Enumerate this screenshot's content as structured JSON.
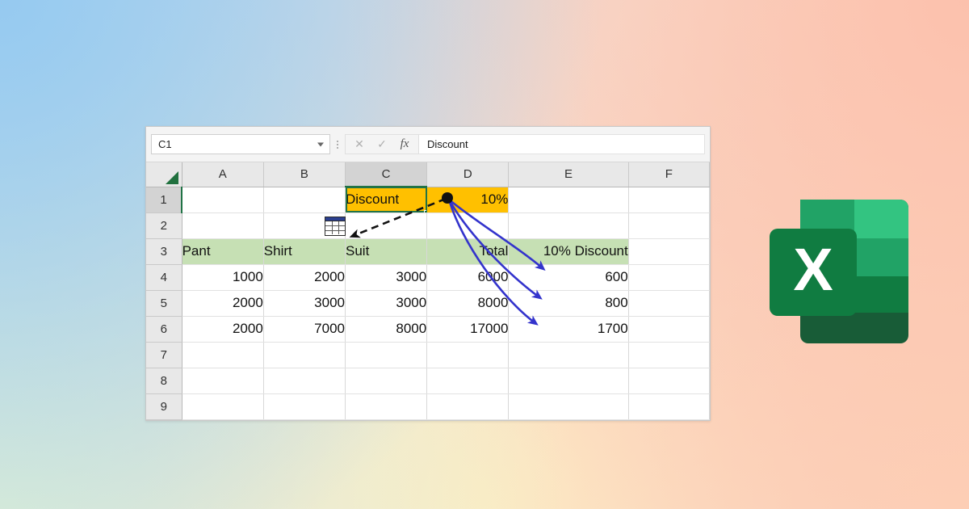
{
  "background": {
    "gradient_colors": [
      "#96CAF0",
      "#FCC1AD",
      "#DEEED6",
      "#FDD1B7",
      "#FDF3C6"
    ]
  },
  "excel": {
    "name_box": {
      "value": "C1",
      "placeholder": "Name Box"
    },
    "toolbar": {
      "cancel_label": "✕",
      "enter_label": "✓",
      "fx_label": "fx",
      "handle_dots": "⋮"
    },
    "formula_bar": {
      "value": "Discount",
      "placeholder": ""
    },
    "columns": [
      "A",
      "B",
      "C",
      "D",
      "E",
      "F"
    ],
    "selected_column": "C",
    "rows": [
      "1",
      "2",
      "3",
      "4",
      "5",
      "6",
      "7",
      "8",
      "9"
    ],
    "selected_row": "1",
    "selected_cell": "C1",
    "cells": {
      "row1": {
        "A": "",
        "B": "",
        "C": "Discount",
        "D": "10%",
        "E": "",
        "F": ""
      },
      "row2": {
        "A": "",
        "B": "",
        "C": "",
        "D": "",
        "E": "",
        "F": ""
      },
      "row3": {
        "A": "Pant",
        "B": "Shirt",
        "C": "Suit",
        "D": "Total",
        "E": "10% Discount",
        "F": ""
      },
      "row4": {
        "A": "1000",
        "B": "2000",
        "C": "3000",
        "D": "6000",
        "E": "600",
        "F": ""
      },
      "row5": {
        "A": "2000",
        "B": "3000",
        "C": "3000",
        "D": "8000",
        "E": "800",
        "F": ""
      },
      "row6": {
        "A": "2000",
        "B": "7000",
        "C": "8000",
        "D": "17000",
        "E": "1700",
        "F": ""
      },
      "row7": {
        "A": "",
        "B": "",
        "C": "",
        "D": "",
        "E": "",
        "F": ""
      },
      "row8": {
        "A": "",
        "B": "",
        "C": "",
        "D": "",
        "E": "",
        "F": ""
      },
      "row9": {
        "A": "",
        "B": "",
        "C": "",
        "D": "",
        "E": "",
        "F": ""
      }
    },
    "fill_colors": {
      "header_row_green": "#C6E0B4",
      "discount_orange": "#FFC000",
      "selection_green": "#217346"
    }
  },
  "annotations": {
    "source_marker": "black-dot-at-D1",
    "dashed_arrow_target": "paste-table-icon",
    "blue_arrows_count": 3,
    "blue_arrow_color": "#3333CC",
    "dashed_arrow_color": "#111111"
  },
  "logo": {
    "letter": "X",
    "name": "excel-logo",
    "colors": {
      "dark": "#185C37",
      "mid": "#21A366",
      "light": "#33C481",
      "deep": "#107C41"
    }
  }
}
